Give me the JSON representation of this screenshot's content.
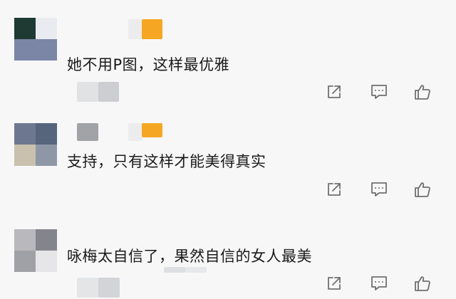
{
  "comments": [
    {
      "text": "她不用P图，这样最优雅"
    },
    {
      "text": "支持，只有这样才能美得真实"
    },
    {
      "text": "咏梅太自信了，果然自信的女人最美"
    }
  ],
  "icons": {
    "share": "share-icon",
    "reply": "comment-icon",
    "like": "thumbs-up-icon"
  },
  "colors": {
    "background": "#f7f7f8",
    "text": "#1a1a1a",
    "icon": "#707070",
    "badge": "#f5a623"
  }
}
